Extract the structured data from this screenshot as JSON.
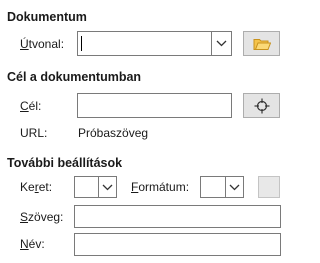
{
  "document": {
    "section_title": "Dokumentum",
    "path_label_first": "Ú",
    "path_label_rest": "tvonal:",
    "path_value": "",
    "open_icon": "folder-icon"
  },
  "target": {
    "section_title": "Cél a dokumentumban",
    "target_label_first": "C",
    "target_label_rest": "él:",
    "target_value": "",
    "target_icon": "crosshair-icon",
    "url_label": "URL:",
    "url_value": "Próbaszöveg"
  },
  "further": {
    "section_title": "További beállítások",
    "frame_label_first": "Ke",
    "frame_label_u": "r",
    "frame_label_rest": "et:",
    "frame_value": "",
    "format_label_first": "F",
    "format_label_rest": "ormátum:",
    "format_value": "",
    "text_label_first": "S",
    "text_label_rest": "zöveg:",
    "text_value": "",
    "name_label_first": "N",
    "name_label_rest": "év:",
    "name_value": ""
  }
}
